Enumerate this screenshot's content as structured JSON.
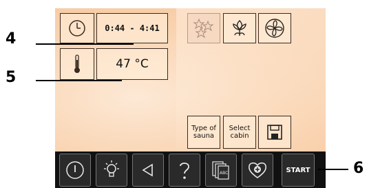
{
  "left_panel": {
    "timer_icon": "clock-icon",
    "time_range": "0:44 - 4:41",
    "thermometer_icon": "thermometer-icon",
    "temperature": "47 °C"
  },
  "mode_buttons": [
    {
      "icon": "stars-icon",
      "state": "inactive"
    },
    {
      "icon": "lotus-icon"
    },
    {
      "icon": "fan-icon"
    }
  ],
  "bottom_buttons": {
    "type_of_sauna": "Type of sauna",
    "select_cabin": "Select cabin",
    "save_icon": "floppy-disk-icon"
  },
  "toolbar": {
    "items": [
      "power-icon",
      "light-icon",
      "back-icon",
      "help-icon",
      "abc-cards-icon",
      "heart-plus-icon"
    ],
    "start_label": "START"
  },
  "callouts": {
    "four": "4",
    "five": "5",
    "six": "6"
  },
  "colors": {
    "screen_bg": "#f9d3b0",
    "toolbar_bg": "#111111",
    "icon_stroke": "#3a2a20"
  }
}
